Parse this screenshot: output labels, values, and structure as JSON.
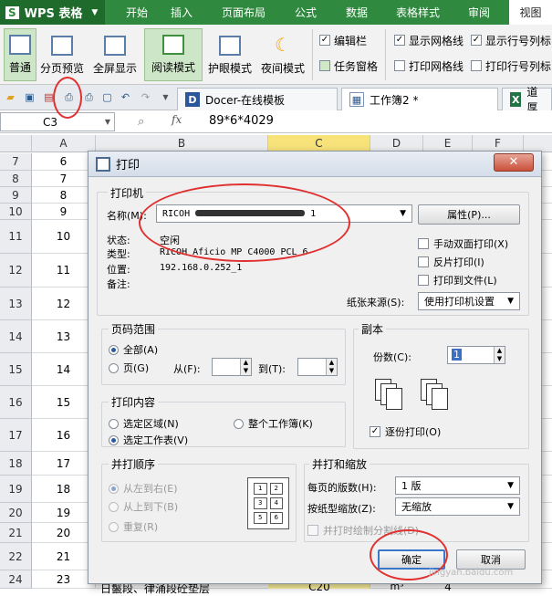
{
  "app": {
    "name": "WPS 表格"
  },
  "menu": {
    "items": [
      "开始",
      "插入",
      "页面布局",
      "公式",
      "数据",
      "表格样式",
      "审阅",
      "视图"
    ]
  },
  "ribbon": {
    "buttons": [
      {
        "label": "普通"
      },
      {
        "label": "分页预览"
      },
      {
        "label": "全屏显示"
      },
      {
        "label": "阅读模式"
      },
      {
        "label": "护眼模式"
      },
      {
        "label": "夜间模式"
      }
    ],
    "checks": [
      {
        "label": "编辑栏",
        "checked": true
      },
      {
        "label": "任务窗格",
        "checked": false
      },
      {
        "label": "显示网格线",
        "checked": true
      },
      {
        "label": "打印网格线",
        "checked": false
      },
      {
        "label": "显示行号列标",
        "checked": true
      },
      {
        "label": "打印行号列标",
        "checked": false
      }
    ]
  },
  "tabs": [
    {
      "label": "Docer-在线模板"
    },
    {
      "label": "工作簿2 *"
    },
    {
      "label": "道厚"
    }
  ],
  "formula": {
    "cell": "C3",
    "fx": "fx",
    "value": "89*6*4029"
  },
  "columns": [
    "A",
    "B",
    "C",
    "D",
    "E",
    "F"
  ],
  "rows": [
    {
      "num": "7",
      "a": "6"
    },
    {
      "num": "8",
      "a": "7"
    },
    {
      "num": "9",
      "a": "8"
    },
    {
      "num": "10",
      "a": "9"
    },
    {
      "num": "11",
      "a": "10"
    },
    {
      "num": "12",
      "a": "11"
    },
    {
      "num": "13",
      "a": "12"
    },
    {
      "num": "14",
      "a": "13"
    },
    {
      "num": "15",
      "a": "14"
    },
    {
      "num": "16",
      "a": "15"
    },
    {
      "num": "17",
      "a": "16"
    },
    {
      "num": "18",
      "a": "17"
    },
    {
      "num": "19",
      "a": "18"
    },
    {
      "num": "20",
      "a": "19"
    },
    {
      "num": "21",
      "a": "20"
    },
    {
      "num": "22",
      "a": "21"
    },
    {
      "num": "24",
      "a": "23"
    }
  ],
  "last_row": {
    "b": "日鬣段、律涌段砼垫层",
    "c": "C20",
    "d": "m³",
    "e": "4"
  },
  "dialog": {
    "title": "打印",
    "printer_group": "打印机",
    "name_label": "名称(M):",
    "printer_name": "RICOH",
    "printer_suffix": "1",
    "props_button": "属性(P)...",
    "status_label": "状态:",
    "status_value": "空闲",
    "type_label": "类型:",
    "type_value": "RICOH Aficio MP C4000 PCL 6",
    "location_label": "位置:",
    "location_value": "192.168.0.252_1",
    "note_label": "备注:",
    "duplex": "手动双面打印(X)",
    "reverse": "反片打印(I)",
    "tofile": "打印到文件(L)",
    "paper_source_label": "纸张来源(S):",
    "paper_source_value": "使用打印机设置",
    "range_group": "页码范围",
    "range_all": "全部(A)",
    "range_pages": "页(G)",
    "range_from": "从(F):",
    "range_to": "到(T):",
    "copies_group": "副本",
    "copies_label": "份数(C):",
    "copies_value": "1",
    "collate": "逐份打印(O)",
    "content_group": "打印内容",
    "content_selection": "选定区域(N)",
    "content_workbook": "整个工作簿(K)",
    "content_sheet": "选定工作表(V)",
    "order_group": "并打顺序",
    "order_lr": "从左到右(E)",
    "order_tb": "从上到下(B)",
    "order_repeat": "重复(R)",
    "order_cells": [
      "1",
      "2",
      "3",
      "4",
      "5",
      "6"
    ],
    "scale_group": "并打和缩放",
    "pages_per_sheet_label": "每页的版数(H):",
    "pages_per_sheet_value": "1 版",
    "scale_label": "按纸型缩放(Z):",
    "scale_value": "无缩放",
    "draw_lines": "并打时绘制分割线(D)",
    "ok": "确定",
    "cancel": "取消"
  },
  "watermark": "jingyan.baidu.com",
  "colors": {
    "accent": "#2f8a3f",
    "selected_col": "#f7e37a",
    "selected_cell": "#fff59d",
    "annotation": "#e03030"
  }
}
